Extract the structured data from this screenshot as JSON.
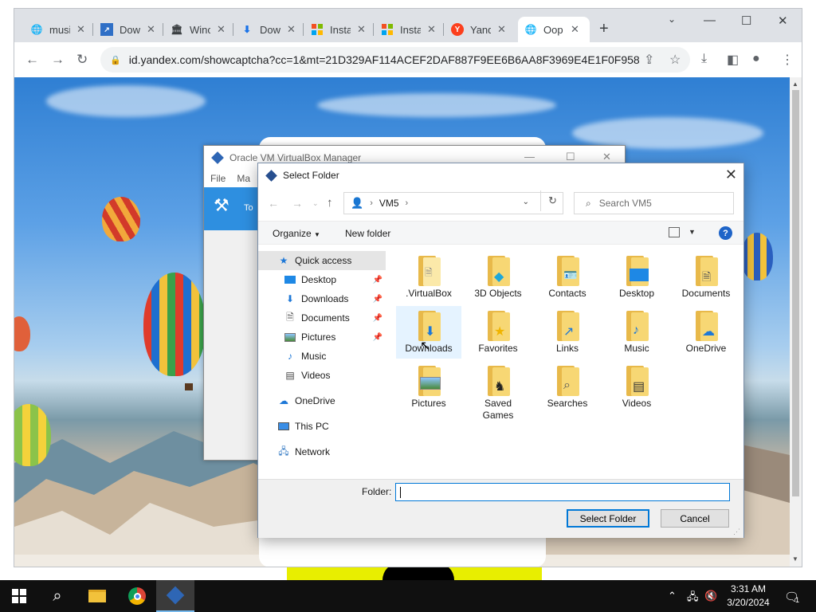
{
  "browser": {
    "tabs": [
      {
        "label": "musi",
        "icon": "globe-icon"
      },
      {
        "label": "Dow",
        "icon": "chart-icon"
      },
      {
        "label": "Winc",
        "icon": "museum-icon"
      },
      {
        "label": "Dow",
        "icon": "download-icon"
      },
      {
        "label": "Insta",
        "icon": "microsoft-icon"
      },
      {
        "label": "Insta",
        "icon": "microsoft-icon"
      },
      {
        "label": "Yand",
        "icon": "yandex-icon"
      },
      {
        "label": "Oop",
        "icon": "globe-icon"
      }
    ],
    "url": "id.yandex.com/showcaptcha?cc=1&mt=21D329AF114ACEF2DAF887F9EE6B6AA8F3969E4E1F0F958F9..."
  },
  "vbox": {
    "title": "Oracle VM VirtualBox Manager",
    "menu": [
      "File",
      "Ma"
    ],
    "tools_label": "To"
  },
  "dialog": {
    "title": "Select Folder",
    "path": "VM5",
    "search_placeholder": "Search VM5",
    "organize_label": "Organize",
    "new_folder_label": "New folder",
    "nav_items": [
      {
        "label": "Quick access",
        "icon": "star-icon"
      },
      {
        "label": "Desktop",
        "icon": "desktop-icon"
      },
      {
        "label": "Downloads",
        "icon": "download-icon"
      },
      {
        "label": "Documents",
        "icon": "document-icon"
      },
      {
        "label": "Pictures",
        "icon": "picture-icon"
      },
      {
        "label": "Music",
        "icon": "music-icon"
      },
      {
        "label": "Videos",
        "icon": "video-icon"
      },
      {
        "label": "OneDrive",
        "icon": "cloud-icon"
      },
      {
        "label": "This PC",
        "icon": "computer-icon"
      },
      {
        "label": "Network",
        "icon": "network-icon"
      }
    ],
    "files": [
      {
        "label": ".VirtualBox"
      },
      {
        "label": "3D Objects"
      },
      {
        "label": "Contacts"
      },
      {
        "label": "Desktop"
      },
      {
        "label": "Documents"
      },
      {
        "label": "Downloads"
      },
      {
        "label": "Favorites"
      },
      {
        "label": "Links"
      },
      {
        "label": "Music"
      },
      {
        "label": "OneDrive"
      },
      {
        "label": "Pictures"
      },
      {
        "label": "Saved Games"
      },
      {
        "label": "Searches"
      },
      {
        "label": "Videos"
      }
    ],
    "folder_label": "Folder:",
    "folder_value": "",
    "select_button": "Select Folder",
    "cancel_button": "Cancel"
  },
  "taskbar": {
    "time": "3:31 AM",
    "date": "3/20/2024",
    "notification_count": "1"
  },
  "colors": {
    "accent": "#0078d7",
    "folder_yellow": "#f7d774",
    "taskbar": "#101010"
  }
}
